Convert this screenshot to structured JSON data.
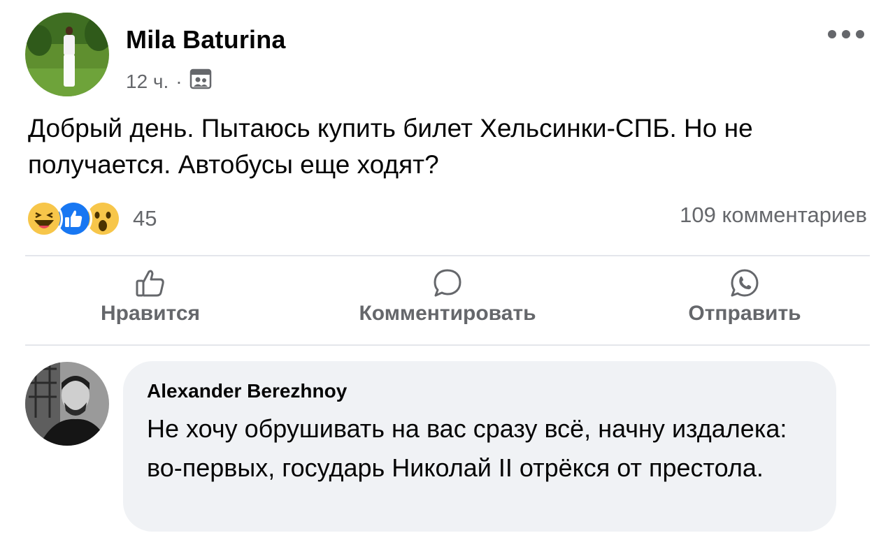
{
  "post": {
    "author": "Mila Baturina",
    "time": "12 ч.",
    "separator": "·",
    "audience_icon": "friends-audience-icon",
    "text": "Добрый день. Пытаюсь купить билет Хельсинки-СПБ. Но не получается. Автобусы еще ходят?",
    "reactions": {
      "icons": [
        "haha-reaction-icon",
        "like-reaction-icon",
        "wow-reaction-icon"
      ],
      "count": "45"
    },
    "comments_count": "109 комментариев"
  },
  "actions": {
    "like": "Нравится",
    "comment": "Комментировать",
    "share": "Отправить"
  },
  "comment": {
    "author": "Alexander Berezhnoy",
    "text": "Не хочу обрушивать на вас сразу всё, начну издалека: во-первых, государь Николай II отрёкся от престола."
  },
  "colors": {
    "secondary_text": "#65676b",
    "primary_text": "#050505",
    "bubble_bg": "#f0f2f5",
    "like_blue": "#1877f2",
    "reaction_yellow": "#f7c64a"
  }
}
